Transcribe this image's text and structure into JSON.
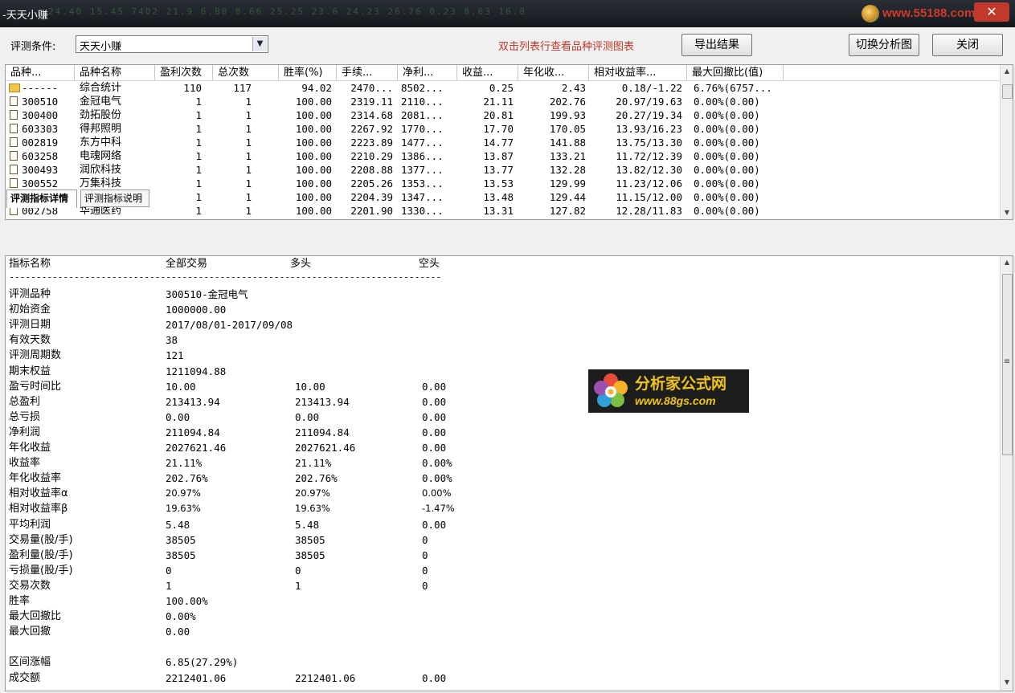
{
  "window": {
    "title": "-天天小赚",
    "ticker_text": "24.40   15.45   7402   21.9   6.80   8.66   25.25   23.6   24.23   26.76      0.23   8.63   16.8",
    "watermark": "www.55188.com",
    "close_glyph": "✕"
  },
  "toolbar": {
    "condition_label": "评测条件:",
    "condition_value": "天天小赚",
    "hint": "双击列表行查看品种评测图表",
    "export_label": "导出结果",
    "switch_label": "切换分析图",
    "close_label": "关闭"
  },
  "table": {
    "columns": [
      "品种...",
      "品种名称",
      "盈利次数",
      "总次数",
      "胜率(%)",
      "手续...",
      "净利...",
      "收益...",
      "年化收...",
      "相对收益率...",
      "最大回撤比(值)"
    ],
    "rows": [
      {
        "code": "------",
        "name": "综合统计",
        "wins": "110",
        "total": "117",
        "winrate": "94.02",
        "fee": "2470...",
        "net": "8502...",
        "ret": "0.25",
        "annual": "2.43",
        "rel": "0.18/-1.22",
        "maxdd": "6.76%(6757...",
        "icon": "folder-icon"
      },
      {
        "code": "300510",
        "name": "金冠电气",
        "wins": "1",
        "total": "1",
        "winrate": "100.00",
        "fee": "2319.11",
        "net": "2110...",
        "ret": "21.11",
        "annual": "202.76",
        "rel": "20.97/19.63",
        "maxdd": "0.00%(0.00)",
        "icon": "doc-icon"
      },
      {
        "code": "300400",
        "name": "劲拓股份",
        "wins": "1",
        "total": "1",
        "winrate": "100.00",
        "fee": "2314.68",
        "net": "2081...",
        "ret": "20.81",
        "annual": "199.93",
        "rel": "20.27/19.34",
        "maxdd": "0.00%(0.00)",
        "icon": "doc-icon"
      },
      {
        "code": "603303",
        "name": "得邦照明",
        "wins": "1",
        "total": "1",
        "winrate": "100.00",
        "fee": "2267.92",
        "net": "1770...",
        "ret": "17.70",
        "annual": "170.05",
        "rel": "13.93/16.23",
        "maxdd": "0.00%(0.00)",
        "icon": "doc-icon"
      },
      {
        "code": "002819",
        "name": "东方中科",
        "wins": "1",
        "total": "1",
        "winrate": "100.00",
        "fee": "2223.89",
        "net": "1477...",
        "ret": "14.77",
        "annual": "141.88",
        "rel": "13.75/13.30",
        "maxdd": "0.00%(0.00)",
        "icon": "doc-icon"
      },
      {
        "code": "603258",
        "name": "电魂网络",
        "wins": "1",
        "total": "1",
        "winrate": "100.00",
        "fee": "2210.29",
        "net": "1386...",
        "ret": "13.87",
        "annual": "133.21",
        "rel": "11.72/12.39",
        "maxdd": "0.00%(0.00)",
        "icon": "doc-icon"
      },
      {
        "code": "300493",
        "name": "润欣科技",
        "wins": "1",
        "total": "1",
        "winrate": "100.00",
        "fee": "2208.88",
        "net": "1377...",
        "ret": "13.77",
        "annual": "132.28",
        "rel": "13.82/12.30",
        "maxdd": "0.00%(0.00)",
        "icon": "doc-icon"
      },
      {
        "code": "300552",
        "name": "万集科技",
        "wins": "1",
        "total": "1",
        "winrate": "100.00",
        "fee": "2205.26",
        "net": "1353...",
        "ret": "13.53",
        "annual": "129.99",
        "rel": "11.23/12.06",
        "maxdd": "0.00%(0.00)",
        "icon": "doc-icon"
      },
      {
        "code": "",
        "name": "",
        "wins": "1",
        "total": "1",
        "winrate": "100.00",
        "fee": "2204.39",
        "net": "1347...",
        "ret": "13.48",
        "annual": "129.44",
        "rel": "11.15/12.00",
        "maxdd": "0.00%(0.00)",
        "icon": "none"
      },
      {
        "code": "002758",
        "name": "华通医药",
        "wins": "1",
        "total": "1",
        "winrate": "100.00",
        "fee": "2201.90",
        "net": "1330...",
        "ret": "13.31",
        "annual": "127.82",
        "rel": "12.28/11.83",
        "maxdd": "0.00%(0.00)",
        "icon": "doc-icon"
      }
    ]
  },
  "tabs": [
    "评测指标详情",
    "评测指标说明"
  ],
  "detail": {
    "headers": [
      "指标名称",
      "全部交易",
      "多头",
      "空头"
    ],
    "separator": "--------------------------------------------------------------------------------",
    "rows": [
      {
        "label": "评测品种",
        "all": "300510-金冠电气",
        "long": "",
        "short": ""
      },
      {
        "label": "初始资金",
        "all": "1000000.00",
        "long": "",
        "short": ""
      },
      {
        "label": "评测日期",
        "all": "2017/08/01-2017/09/08",
        "long": "",
        "short": ""
      },
      {
        "label": "有效天数",
        "all": "38",
        "long": "",
        "short": ""
      },
      {
        "label": "评测周期数",
        "all": "121",
        "long": "",
        "short": ""
      },
      {
        "label": "期末权益",
        "all": "1211094.88",
        "long": "",
        "short": ""
      },
      {
        "label": "盈亏时间比",
        "all": "10.00",
        "long": "10.00",
        "short": "0.00"
      },
      {
        "label": "总盈利",
        "all": "213413.94",
        "long": "213413.94",
        "short": "0.00"
      },
      {
        "label": "总亏损",
        "all": "0.00",
        "long": "0.00",
        "short": "0.00"
      },
      {
        "label": "净利润",
        "all": "211094.84",
        "long": "211094.84",
        "short": "0.00"
      },
      {
        "label": "年化收益",
        "all": "2027621.46",
        "long": "2027621.46",
        "short": "0.00"
      },
      {
        "label": "收益率",
        "all": "21.11%",
        "long": "21.11%",
        "short": "0.00%"
      },
      {
        "label": "年化收益率",
        "all": "202.76%",
        "long": "202.76%",
        "short": "0.00%"
      },
      {
        "label": "相对收益率α",
        "all": "20.97%",
        "long": "20.97%",
        "short": "0.00%",
        "small": true
      },
      {
        "label": "相对收益率β",
        "all": "19.63%",
        "long": "19.63%",
        "short": "-1.47%",
        "small": true
      },
      {
        "label": "平均利润",
        "all": "5.48",
        "long": "5.48",
        "short": "0.00"
      },
      {
        "label": "交易量(股/手)",
        "all": "38505",
        "long": "38505",
        "short": "0"
      },
      {
        "label": "盈利量(股/手)",
        "all": "38505",
        "long": "38505",
        "short": "0"
      },
      {
        "label": "亏损量(股/手)",
        "all": "0",
        "long": "0",
        "short": "0"
      },
      {
        "label": "交易次数",
        "all": "1",
        "long": "1",
        "short": "0"
      },
      {
        "label": "胜率",
        "all": "100.00%",
        "long": "",
        "short": ""
      },
      {
        "label": "最大回撤比",
        "all": "0.00%",
        "long": "",
        "short": ""
      },
      {
        "label": "最大回撤",
        "all": "0.00",
        "long": "",
        "short": ""
      },
      {
        "label": "",
        "all": "",
        "long": "",
        "short": ""
      },
      {
        "label": "区间涨幅",
        "all": "6.85(27.29%)",
        "long": "",
        "short": ""
      },
      {
        "label": "成交额",
        "all": "2212401.06",
        "long": "2212401.06",
        "short": "0.00"
      }
    ]
  },
  "logo": {
    "title": "分析家公式网",
    "url": "www.88gs.com"
  }
}
